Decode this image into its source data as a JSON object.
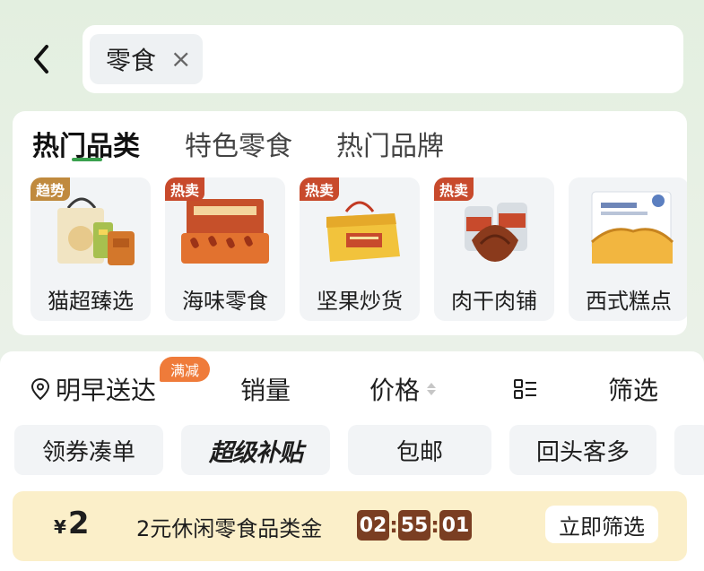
{
  "search": {
    "query_chip": "零食",
    "clear_symbol": "×"
  },
  "category_tabs": [
    {
      "label": "热门品类",
      "active": true
    },
    {
      "label": "特色零食",
      "active": false
    },
    {
      "label": "热门品牌",
      "active": false
    }
  ],
  "categories": [
    {
      "label": "猫超臻选",
      "badge": "趋势",
      "icon": "snack-gift-bag-icon"
    },
    {
      "label": "海味零食",
      "badge": "热卖",
      "icon": "seafood-snack-box-icon"
    },
    {
      "label": "坚果炒货",
      "badge": "热卖",
      "icon": "nut-gift-box-icon"
    },
    {
      "label": "肉干肉铺",
      "badge": "热卖",
      "icon": "jerky-jar-icon"
    },
    {
      "label": "西式糕点",
      "badge": "",
      "icon": "cake-box-icon"
    }
  ],
  "sort_bar": {
    "delivery": "明早送达",
    "promo_badge": "满减",
    "sales": "销量",
    "price": "价格",
    "filter": "筛选"
  },
  "quick_filters": [
    "领券凑单",
    "超级补贴",
    "包邮",
    "回头客多"
  ],
  "coupon": {
    "currency": "¥",
    "amount": "2",
    "description": "2元休闲零食品类金",
    "timer": [
      "02",
      "55",
      "01"
    ],
    "action": "立即筛选"
  },
  "colors": {
    "accent_green": "#3aa14e",
    "hot_badge": "#c84a2c",
    "trend_badge": "#c08a3e",
    "promo_orange": "#ef7b3a",
    "coupon_bg": "#fbefc9",
    "timer_bg": "#7a3e22"
  }
}
